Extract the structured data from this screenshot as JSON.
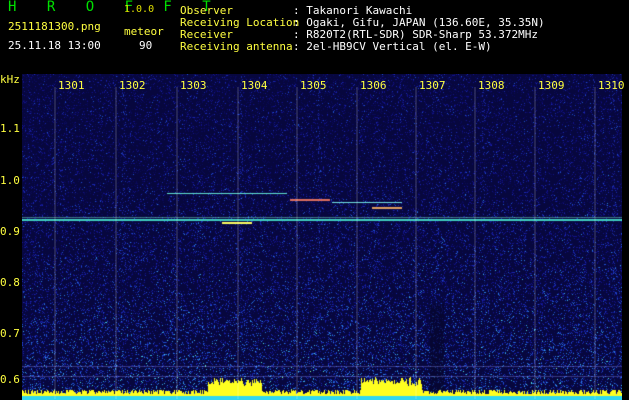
{
  "header": {
    "brand": "H R O F F T",
    "version": "1.0.0",
    "filename": "2511181300.png",
    "mode": "meteor",
    "datetime": "25.11.18 13:00",
    "count": "90",
    "observer_label": "Observer",
    "observer_value": ": Takanori Kawachi",
    "location_label": "Receiving Location",
    "location_value": ": Ogaki, Gifu, JAPAN (136.60E, 35.35N)",
    "receiver_label": "Receiver",
    "receiver_value": ": R820T2(RTL-SDR) SDR-Sharp 53.372MHz",
    "antenna_label": "Receiving antenna",
    "antenna_value": ": 2el-HB9CV Vertical (el. E-W)"
  },
  "axes": {
    "y_unit": "kHz",
    "x_ticks": [
      "1301",
      "1302",
      "1303",
      "1304",
      "1305",
      "1306",
      "1307",
      "1308",
      "1309",
      "1310"
    ],
    "y_ticks": [
      "1.1",
      "1.0",
      "0.9",
      "0.8",
      "0.7",
      "0.6"
    ]
  },
  "colors": {
    "background": "#000000",
    "header_text": "#ffff40",
    "value_text": "#ffffff",
    "brand": "#00e000"
  }
}
